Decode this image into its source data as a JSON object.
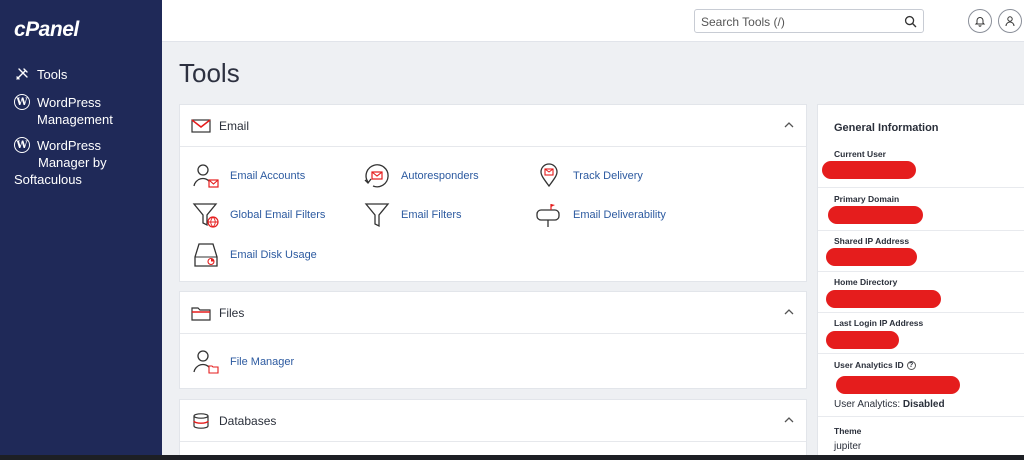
{
  "sidebar": {
    "logo": "cPanel",
    "items": [
      {
        "label": "Tools",
        "icon": "tools-icon"
      },
      {
        "label_lines": [
          "WordPress",
          "Management"
        ],
        "icon": "wordpress-icon"
      },
      {
        "label_lines": [
          "WordPress",
          "Manager by",
          "Softaculous"
        ],
        "icon": "wordpress-icon"
      }
    ]
  },
  "topbar": {
    "search_placeholder": "Search Tools (/)",
    "bell_icon": "bell-icon",
    "user_icon": "user-icon"
  },
  "page_title": "Tools",
  "panels": {
    "email": {
      "title": "Email",
      "tools": [
        {
          "label": "Email Accounts",
          "icon": "email-accounts-icon"
        },
        {
          "label": "Autoresponders",
          "icon": "autoresponders-icon"
        },
        {
          "label": "Track Delivery",
          "icon": "track-delivery-icon"
        },
        {
          "label": "Global Email Filters",
          "icon": "global-email-filters-icon"
        },
        {
          "label": "Email Filters",
          "icon": "email-filters-icon"
        },
        {
          "label": "Email Deliverability",
          "icon": "email-deliverability-icon"
        },
        {
          "label": "Email Disk Usage",
          "icon": "email-disk-usage-icon"
        }
      ]
    },
    "files": {
      "title": "Files",
      "tools": [
        {
          "label": "File Manager",
          "icon": "file-manager-icon"
        }
      ]
    },
    "databases": {
      "title": "Databases"
    }
  },
  "info": {
    "title": "General Information",
    "rows": {
      "current_user": "Current User",
      "primary_domain": "Primary Domain",
      "shared_ip": "Shared IP Address",
      "home_directory": "Home Directory",
      "last_login_ip": "Last Login IP Address",
      "analytics_id": "User Analytics ID",
      "analytics_prefix": "User Analytics: ",
      "analytics_status": "Disabled",
      "theme_label": "Theme",
      "theme_value": "jupiter"
    }
  },
  "colors": {
    "sidebar_bg": "#1f2958",
    "accent_red": "#e51d1d",
    "link_blue": "#2c5aa0"
  }
}
